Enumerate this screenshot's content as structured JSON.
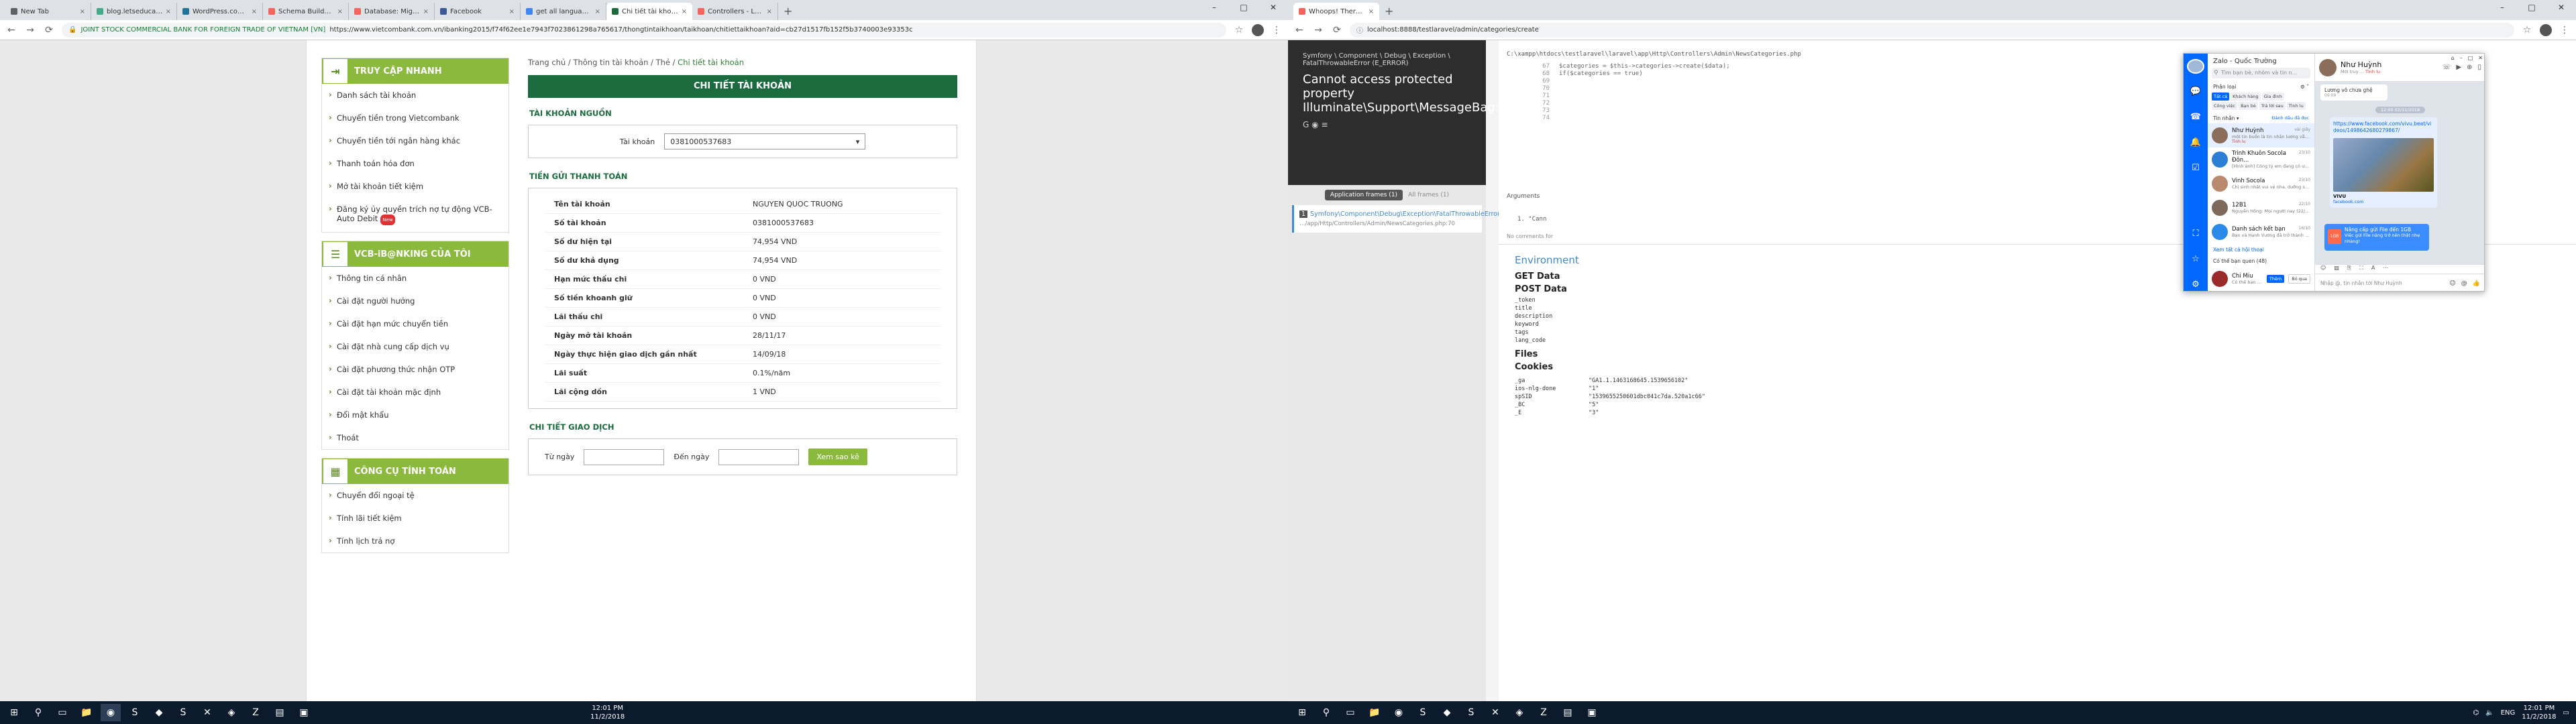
{
  "left": {
    "tabs": [
      {
        "label": "New Tab",
        "color": "#5f6368",
        "active": false
      },
      {
        "label": "blog.letseducate.admi...",
        "color": "#4a8",
        "active": false
      },
      {
        "label": "WordPress.com and W...",
        "color": "#21759b",
        "active": false
      },
      {
        "label": "Schema Builder - Larav...",
        "color": "#f4645f",
        "active": false
      },
      {
        "label": "Database: Migrations -...",
        "color": "#f4645f",
        "active": false
      },
      {
        "label": "Facebook",
        "color": "#3b5998",
        "active": false
      },
      {
        "label": "get all languages larav...",
        "color": "#4285f4",
        "active": false
      },
      {
        "label": "Chi tiết tài khoản - Ng...",
        "color": "#1b6b3e",
        "active": true
      },
      {
        "label": "Controllers - Laravel - T...",
        "color": "#f4645f",
        "active": false
      }
    ],
    "address": {
      "secure_label": "JOINT STOCK COMMERCIAL BANK FOR FOREIGN TRADE OF VIETNAM [VN]",
      "url": "https://www.vietcombank.com.vn/ibanking2015/f74f62ee1e7943f7023861298a765617/thongtintaikhoan/taikhoan/chitiettaikhoan?aid=cb27d1517fb152f5b3740003e93353c"
    },
    "sidebar": {
      "quick": {
        "title": "TRUY CẬP NHANH",
        "items": [
          {
            "label": "Danh sách tài khoản"
          },
          {
            "label": "Chuyển tiền trong Vietcombank"
          },
          {
            "label": "Chuyển tiền tới ngân hàng khác"
          },
          {
            "label": "Thanh toán hóa đơn"
          },
          {
            "label": "Mở tài khoản tiết kiệm"
          },
          {
            "label": "Đăng ký ủy quyền trích nợ tự động VCB-Auto Debit",
            "badge": "New"
          }
        ]
      },
      "mine": {
        "title": "VCB-iB@NKING CỦA TÔI",
        "items": [
          {
            "label": "Thông tin cá nhân"
          },
          {
            "label": "Cài đặt người hưởng"
          },
          {
            "label": "Cài đặt hạn mức chuyển tiền"
          },
          {
            "label": "Cài đặt nhà cung cấp dịch vụ"
          },
          {
            "label": "Cài đặt phương thức nhận OTP"
          },
          {
            "label": "Cài đặt tài khoản mặc định"
          },
          {
            "label": "Đổi mật khẩu"
          },
          {
            "label": "Thoát"
          }
        ]
      },
      "tools": {
        "title": "CÔNG CỤ TÍNH TOÁN",
        "items": [
          {
            "label": "Chuyển đổi ngoại tệ"
          },
          {
            "label": "Tính lãi tiết kiệm"
          },
          {
            "label": "Tính lịch trả nợ"
          }
        ]
      }
    },
    "main": {
      "breadcrumb_prefix": "Trang chủ / Thông tin tài khoản / Thẻ / ",
      "breadcrumb_current": "Chi tiết tài khoản",
      "title": "CHI TIẾT TÀI KHOẢN",
      "source_title": "TÀI KHOẢN NGUỒN",
      "account_label": "Tài khoản",
      "account_value": "0381000537683",
      "deposit_title": "TIỀN GỬI THANH TOÁN",
      "details": [
        {
          "k": "Tên tài khoản",
          "v": "NGUYEN QUOC TRUONG"
        },
        {
          "k": "Số tài khoản",
          "v": "0381000537683"
        },
        {
          "k": "Số dư hiện tại",
          "v": "74,954 VND"
        },
        {
          "k": "Số dư khả dụng",
          "v": "74,954 VND"
        },
        {
          "k": "Hạn mức thấu chi",
          "v": "0 VND"
        },
        {
          "k": "Số tiền khoanh giữ",
          "v": "0 VND"
        },
        {
          "k": "Lãi thấu chi",
          "v": "0 VND"
        },
        {
          "k": "Ngày mở tài khoản",
          "v": "28/11/17"
        },
        {
          "k": "Ngày thực hiện giao dịch gần nhất",
          "v": "14/09/18"
        },
        {
          "k": "Lãi suất",
          "v": "0.1%/năm"
        },
        {
          "k": "Lãi cộng dồn",
          "v": "1 VND"
        }
      ],
      "tx_title": "CHI TIẾT GIAO DỊCH",
      "from_label": "Từ ngày",
      "to_label": "Đến ngày",
      "view_button": "Xem sao kê"
    },
    "clock": {
      "time": "12:01 PM",
      "date": "11/2/2018"
    }
  },
  "right": {
    "tabs": [
      {
        "label": "Whoops! There was an error.",
        "color": "#f4645f",
        "active": true
      }
    ],
    "address": {
      "url": "localhost:8888/testlaravel/admin/categories/create"
    },
    "whoops": {
      "exception_class": "Symfony \\ Component \\ Debug \\ Exception \\ FatalThrowableError",
      "exception_type": "(E_ERROR)",
      "message": "Cannot access protected property Illuminate\\Support\\MessageBag::$messages",
      "app_frames": "Application frames (1)",
      "all_frames": "All frames (1)",
      "frame_number": "1",
      "frame_class": "Symfony\\Component\\Debug\\Exception\\FatalThrowableError",
      "frame_path": "…/app/Http/Controllers/Admin/NewsCategories.php:70",
      "code_path": "C:\\xampp\\htdocs\\testlaravel\\laravel\\app\\Http\\Controllers\\Admin\\NewsCategories.php",
      "code_lines": [
        {
          "n": "67",
          "t": "$categories = $this->categories->create($data);"
        },
        {
          "n": "68",
          "t": "if($categories == true)"
        },
        {
          "n": "69",
          "t": ""
        },
        {
          "n": "70",
          "t": ""
        },
        {
          "n": "71",
          "t": ""
        },
        {
          "n": "72",
          "t": ""
        },
        {
          "n": "73",
          "t": ""
        },
        {
          "n": "74",
          "t": ""
        }
      ],
      "arguments_label": "Arguments",
      "argument_1": "\"Cann",
      "no_comments": "No comments for",
      "env_title": "Environment",
      "get_data": "GET Data",
      "post_data": "POST Data",
      "post_fields": [
        "_token",
        "title",
        "description",
        "keyword",
        "tags",
        "lang_code"
      ],
      "files_label": "Files",
      "cookies_label": "Cookies",
      "cookies": [
        {
          "k": "_ga",
          "v": "\"GA1.1.1463168645.1539656102\""
        },
        {
          "k": "ios-nlg-done",
          "v": "\"1\""
        },
        {
          "k": "spSID",
          "v": "\"1539655250601dbc041c7da.520a1c66\""
        },
        {
          "k": "_BC",
          "v": "\"5\""
        },
        {
          "k": "_E",
          "v": "\"3\""
        }
      ]
    },
    "zalo": {
      "title": "Zalo - Quốc Trường",
      "search_placeholder": "Tìm bạn bè, nhóm và tin n...",
      "category_label": "Phân loại",
      "chips": [
        "Tất cả",
        "Khách hàng",
        "Gia đình",
        "Công việc",
        "Bạn bè",
        "Trả lời sau",
        "Tình lu"
      ],
      "inbox_label": "Tin nhắn ▾",
      "mark_read": "Đánh dấu đã đọc",
      "conversations": [
        {
          "name": "Như Huỳnh",
          "time": "vài giây",
          "msg": "một tin buồn là tin nhắn lương vẫn...",
          "tag": "Tình lu",
          "color": "#8a6d5a",
          "selected": true
        },
        {
          "name": "Trình Khuôn Socola Đôn...",
          "time": "23/10",
          "msg": "[Hình ảnh] Công ty em đang có ưu ...",
          "tag": "",
          "color": "#2b7fd4",
          "selected": false
        },
        {
          "name": "Vinh Socola",
          "time": "23/10",
          "msg": "Chị sinh nhật vui vẻ nha, dưỡng sức...",
          "tag": "",
          "color": "#b98a6e",
          "selected": false
        },
        {
          "name": "12B1",
          "time": "22/10",
          "msg": "Nguyễn Hồng: Mọi người nay (22/10) là ...",
          "tag": "",
          "color": "#7d6a5a",
          "selected": false
        },
        {
          "name": "Danh sách kết bạn",
          "time": "16/10",
          "msg": "Bạn và Hạnh Vương đã trở thành b...",
          "tag": "",
          "color": "#2b8ae8",
          "selected": false
        }
      ],
      "see_all": "Xem tất cả hội thoại",
      "maybe_know": "Có thể bạn quen (48)",
      "suggest_name": "Chi Miu",
      "suggest_sub": "Có thể bạn quen",
      "add_btn": "Thêm",
      "skip_btn": "Bỏ qua",
      "chat_name": "Như Huỳnh",
      "chat_status": "Mới truy ...",
      "chat_tag": "Tình lu",
      "msg1": "Lương vô chưa ghệ",
      "msg1_time": "09:09",
      "date_sep": "12:00 02/11/2018",
      "link_url": "https://www.facebook.com/vivu.beat/videos/1498642680279867/",
      "link_title": "VIVU",
      "link_domain": "facebook.com",
      "promo_icon": "1GB",
      "promo_title": "Nâng cấp gửi File đến 1GB",
      "promo_desc": "Việc gửi File nặng trở nên thật nhẹ nhàng!",
      "input_placeholder": "Nhập @, tin nhắn tới Như Huỳnh"
    },
    "clock": {
      "time": "12:01 PM",
      "date": "11/2/2018"
    },
    "lang": "ENG"
  }
}
